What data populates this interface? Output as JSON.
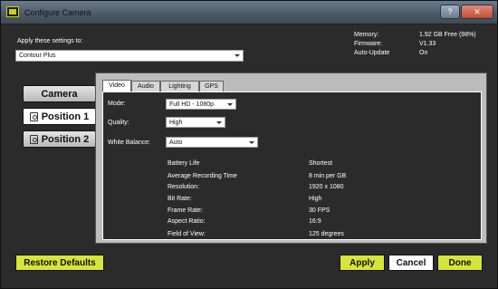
{
  "window": {
    "title": "Configure Camera",
    "help": "?",
    "close": "✕"
  },
  "apply": {
    "label": "Apply these settings to:",
    "value": "Contour Plus"
  },
  "info": {
    "memory_label": "Memory:",
    "memory_value": "1.92 GB Free (98%)",
    "firmware_label": "Firmware:",
    "firmware_value": "V1.33",
    "autoupdate_label": "Auto-Update",
    "autoupdate_value": "On"
  },
  "nav": {
    "camera": "Camera",
    "position1": "Position 1",
    "position2": "Position 2"
  },
  "tabs": [
    "Video",
    "Audio",
    "Lighting",
    "GPS"
  ],
  "form": {
    "mode_label": "Mode:",
    "mode_value": "Full HD - 1080p",
    "quality_label": "Quality:",
    "quality_value": "High",
    "wb_label": "White Balance:",
    "wb_value": "Auto"
  },
  "stats": [
    {
      "label": "Battery Life",
      "value": "Shortest"
    },
    {
      "label": "Average Recording Time",
      "value": "8 min per GB"
    },
    {
      "label": "Resolution:",
      "value": "1920 x 1080"
    },
    {
      "label": "Bit Rate:",
      "value": "High"
    },
    {
      "label": "Frame Rate:",
      "value": "30 FPS"
    },
    {
      "label": "Aspect Ratio:",
      "value": "16:9"
    },
    {
      "label": "Field of View:",
      "value": "125 degrees"
    }
  ],
  "footer": {
    "restore": "Restore Defaults",
    "apply": "Apply",
    "cancel": "Cancel",
    "done": "Done"
  }
}
